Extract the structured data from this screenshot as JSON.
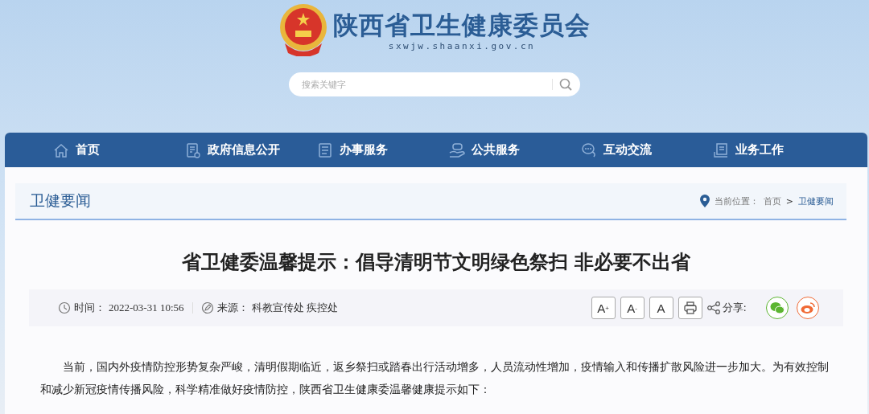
{
  "header": {
    "site_title": "陕西省卫生健康委员会",
    "site_url": "sxwjw.shaanxi.gov.cn",
    "search": {
      "placeholder": "搜索关键字"
    }
  },
  "nav": [
    {
      "label": "首页",
      "kind": "home"
    },
    {
      "label": "政府信息公开",
      "kind": "doc"
    },
    {
      "label": "办事服务",
      "kind": "list"
    },
    {
      "label": "公共服务",
      "kind": "hand"
    },
    {
      "label": "互动交流",
      "kind": "chat"
    },
    {
      "label": "业务工作",
      "kind": "book"
    }
  ],
  "section": {
    "title": "卫健要闻",
    "location_label": "当前位置：",
    "breadcrumb": [
      {
        "label": "首页",
        "current": false
      },
      {
        "label": "卫健要闻",
        "current": true
      }
    ],
    "separator": ">"
  },
  "article": {
    "title": "省卫健委温馨提示：倡导清明节文明绿色祭扫 非必要不出省",
    "meta": [
      {
        "kind": "time",
        "label": "时间：",
        "value": "2022-03-31 10:56"
      },
      {
        "kind": "source",
        "label": "来源：",
        "value": "科教宣传处 疾控处"
      }
    ],
    "font_buttons": [
      "A$^{+}$",
      "A$^{-}$",
      "A"
    ],
    "share_label": "分享:",
    "share": [
      {
        "kind": "wechat",
        "color": "#5cb531"
      },
      {
        "kind": "weibo",
        "color": "#f06a35"
      }
    ],
    "body": [
      "当前，国内外疫情防控形势复杂严峻，清明假期临近，返乡祭扫或踏春出行活动增多，人员流动性增加，疫情输入和传播扩散风险进一步加大。为有效控制和减少新冠疫情传播风险，科学精准做好疫情防控，陕西省卫生健康委温馨健康提示如下："
    ]
  }
}
